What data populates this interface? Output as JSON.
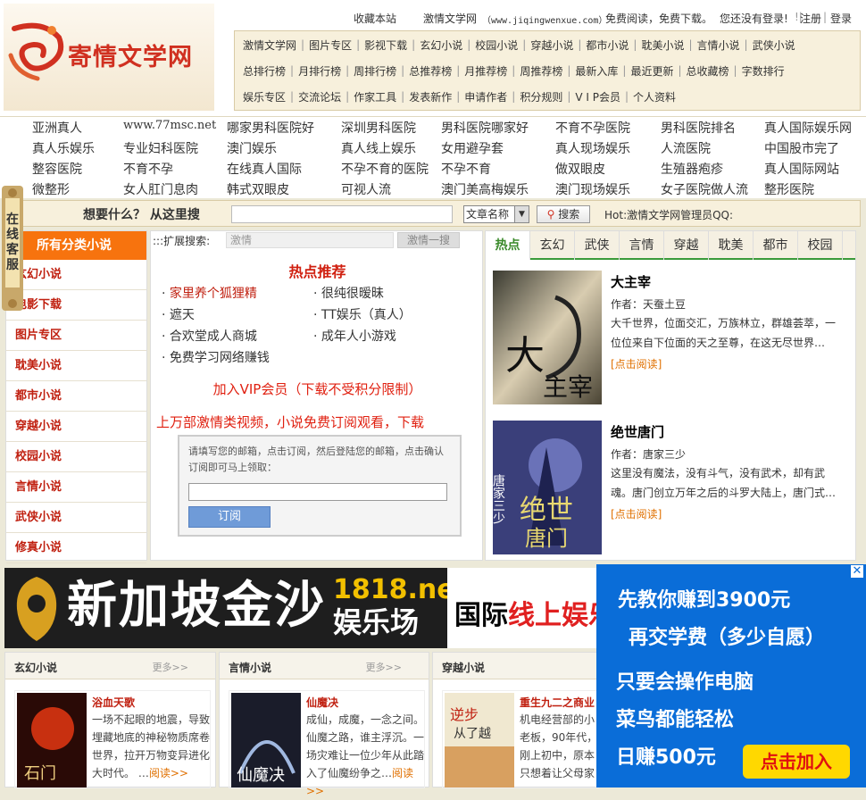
{
  "site": {
    "name": "寄情文学网",
    "brand_color": "#d03020"
  },
  "topbar": {
    "bookmark": "收藏本站",
    "welcome": "激情文学网",
    "domain": "www.jiqingwenxue.com",
    "welcome_tail": "免费阅读，免费下载。",
    "login_status": "您还没有登录!",
    "register": "注册",
    "login": "登录"
  },
  "nav": {
    "rows": [
      [
        "激情文学网",
        "图片专区",
        "影视下载",
        "玄幻小说",
        "校园小说",
        "穿越小说",
        "都市小说",
        "耽美小说",
        "言情小说",
        "武侠小说"
      ],
      [
        "总排行榜",
        "月排行榜",
        "周排行榜",
        "总推荐榜",
        "月推荐榜",
        "周推荐榜",
        "最新入库",
        "最近更新",
        "总收藏榜",
        "字数排行"
      ],
      [
        "娱乐专区",
        "交流论坛",
        "作家工具",
        "发表新作",
        "申请作者",
        "积分规则",
        "V I P会员",
        "个人资料"
      ]
    ]
  },
  "adlinks": {
    "rows": [
      [
        "亚洲真人",
        "www.77msc.net",
        "哪家男科医院好",
        "深圳男科医院",
        "男科医院哪家好",
        "不育不孕医院",
        "男科医院排名",
        "真人国际娱乐网"
      ],
      [
        "真人乐娱乐",
        "专业妇科医院",
        "澳门娱乐",
        "真人线上娱乐",
        "女用避孕套",
        "真人现场娱乐",
        "人流医院",
        "中国股市完了"
      ],
      [
        "整容医院",
        "不育不孕",
        "在线真人国际",
        "不孕不育的医院",
        "不孕不育",
        "做双眼皮",
        "生殖器疱疹",
        "真人国际网站"
      ],
      [
        "微整形",
        "女人肛门息肉",
        "韩式双眼皮",
        "可视人流",
        "澳门美高梅娱乐",
        "澳门现场娱乐",
        "女子医院做人流",
        "整形医院"
      ]
    ]
  },
  "search": {
    "prompt": "想要什么？ 从这里搜",
    "select_value": "文章名称",
    "button": "搜索",
    "hotline": "Hot:激情文学网管理员QQ:"
  },
  "sidebar": {
    "title": "所有分类小说",
    "kefu": "在线客服",
    "items": [
      "玄幻小说",
      "电影下载",
      "图片专区",
      "耽美小说",
      "都市小说",
      "穿越小说",
      "校园小说",
      "言情小说",
      "武侠小说",
      "修真小说"
    ]
  },
  "middle": {
    "ext_label": ":::扩展搜索:",
    "ext_placeholder": "激情",
    "ext_button": "激情一搜",
    "hot_title": "热点推荐",
    "hot_left": [
      "家里养个狐狸精",
      "遮天",
      "合欢堂成人商城",
      "免费学习网络赚钱"
    ],
    "hot_right": [
      "很纯很暧昧",
      "TT娱乐（真人）",
      "成年人小游戏"
    ],
    "vip_line": "加入VIP会员（下载不受积分限制）",
    "promo_line": "上万部激情类视频，小说免费订阅观看，下载",
    "subscribe_hint": "请填写您的邮箱，点击订阅，然后登陆您的邮箱，点击确认订阅即可马上领取：",
    "subscribe_button": "订阅"
  },
  "right": {
    "tabs": [
      "热点",
      "玄幻",
      "武侠",
      "言情",
      "穿越",
      "耽美",
      "都市",
      "校园"
    ],
    "books": [
      {
        "title": "大主宰",
        "author": "作者：天蚕土豆",
        "desc": "大千世界，位面交汇，万族林立，群雄荟萃，一位位来自下位面的天之至尊，在这无尽世界…",
        "read": "[点击阅读]"
      },
      {
        "title": "绝世唐门",
        "author": "作者：唐家三少",
        "desc": "这里没有魔法，没有斗气，没有武术，却有武魂。唐门创立万年之后的斗罗大陆上，唐门式…",
        "read": "[点击阅读]"
      }
    ]
  },
  "banner": {
    "main": "新加坡金沙",
    "sub_top": "1818.net",
    "sub_bottom": "娱乐场",
    "side_a": "国际",
    "side_b": "线上娱乐"
  },
  "floatad": {
    "line1": "先教你赚到3900元",
    "line2": "再交学费（多少自愿）",
    "line3": "只要会操作电脑",
    "line4": "菜鸟都能轻松",
    "line5": "日赚500元",
    "cta": "点击加入"
  },
  "panels": [
    {
      "title": "玄幻小说",
      "more": "更多>>",
      "book": "浴血天歌",
      "desc": "一场不起眼的地震，导致埋藏地底的神秘物质席卷世界，拉开万物变异进化大时代。 …",
      "read": "阅读>>"
    },
    {
      "title": "言情小说",
      "more": "更多>>",
      "book": "仙魔决",
      "desc": "成仙，成魔，一念之间。仙魔之路，谁主浮沉。一场灾难让一位少年从此踏入了仙魔纷争之…",
      "read": "阅读>>"
    },
    {
      "title": "穿越小说",
      "more": "更多>>",
      "book": "重生九二之商业",
      "desc": "机电经营部的小老板，90年代，刚上初中，原本只想着让父母家致富，但命运之…",
      "read": ""
    }
  ]
}
